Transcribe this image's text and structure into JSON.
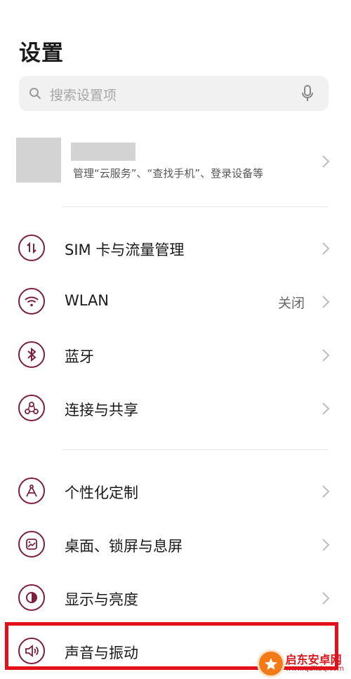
{
  "header": {
    "title": "设置"
  },
  "search": {
    "placeholder": "搜索设置项"
  },
  "account": {
    "subtitle": "管理“云服务”、“查找手机”、登录设备等"
  },
  "settings": {
    "items": [
      {
        "label": "SIM 卡与流量管理",
        "icon": "sim-data-icon",
        "value": ""
      },
      {
        "label": "WLAN",
        "icon": "wifi-icon",
        "value": "关闭"
      },
      {
        "label": "蓝牙",
        "icon": "bluetooth-icon",
        "value": ""
      },
      {
        "label": "连接与共享",
        "icon": "connection-share-icon",
        "value": ""
      },
      {
        "label": "个性化定制",
        "icon": "personalization-icon",
        "value": ""
      },
      {
        "label": "桌面、锁屏与息屏",
        "icon": "wallpaper-icon",
        "value": ""
      },
      {
        "label": "显示与亮度",
        "icon": "brightness-icon",
        "value": ""
      },
      {
        "label": "声音与振动",
        "icon": "speaker-icon",
        "value": ""
      }
    ]
  },
  "watermark": {
    "name": "启东安卓网",
    "url": "www.qdltdq.com"
  },
  "colors": {
    "accent": "#7d1e3c",
    "highlight": "#e3101b",
    "background": "#ffffff"
  }
}
